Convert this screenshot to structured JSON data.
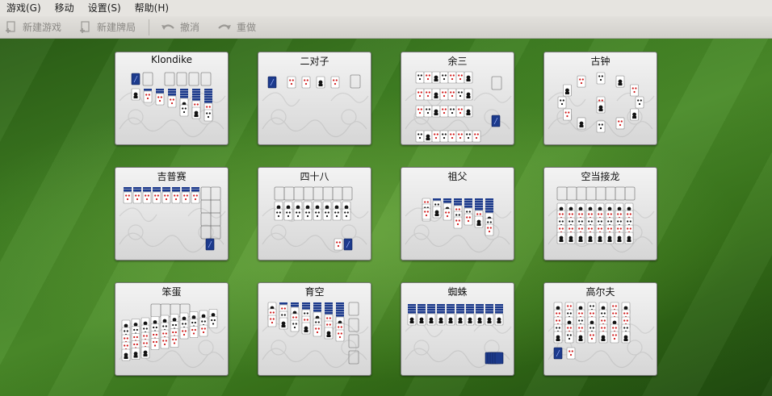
{
  "menubar": {
    "items": [
      "游戏(G)",
      "移动",
      "设置(S)",
      "帮助(H)"
    ]
  },
  "toolbar": {
    "new_game": "新建游戏",
    "new_deal": "新建牌局",
    "undo": "撤消",
    "redo": "重做"
  },
  "games": [
    {
      "name": "Klondike",
      "layout": "klondike"
    },
    {
      "name": "二对子",
      "layout": "twopair"
    },
    {
      "name": "余三",
      "layout": "yusan"
    },
    {
      "name": "古钟",
      "layout": "clock"
    },
    {
      "name": "吉普赛",
      "layout": "gypsy"
    },
    {
      "name": "四十八",
      "layout": "fortyeight"
    },
    {
      "name": "祖父",
      "layout": "grandfather"
    },
    {
      "name": "空当接龙",
      "layout": "freecell"
    },
    {
      "name": "笨蛋",
      "layout": "fool"
    },
    {
      "name": "育空",
      "layout": "yukon"
    },
    {
      "name": "蜘蛛",
      "layout": "spider"
    },
    {
      "name": "高尔夫",
      "layout": "golf"
    }
  ],
  "colors": {
    "felt": "#3f7f22",
    "card_back": "#1c3a8c",
    "red_suit": "#d01818",
    "black_suit": "#111111"
  }
}
